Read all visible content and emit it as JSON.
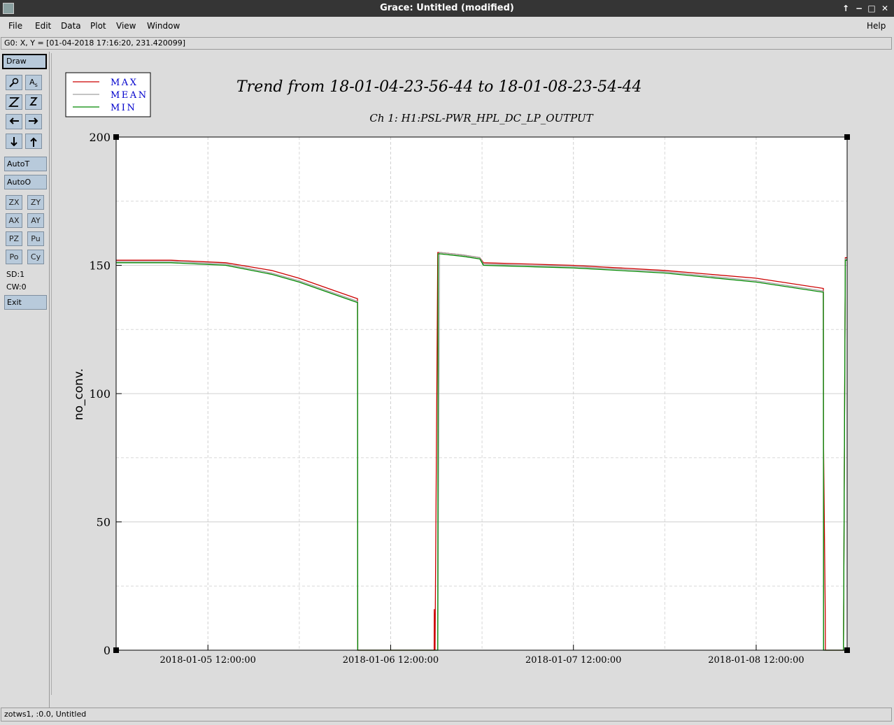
{
  "window": {
    "title": "Grace: Untitled (modified)"
  },
  "menu": {
    "file": "File",
    "edit": "Edit",
    "data": "Data",
    "plot": "Plot",
    "view": "View",
    "window": "Window",
    "help": "Help"
  },
  "locator": "G0: X, Y = [01-04-2018 17:16:20, 231.420099]",
  "toolbar": {
    "draw": "Draw",
    "autoT": "AutoT",
    "autoO": "AutoO",
    "small": [
      "ZX",
      "ZY",
      "AX",
      "AY",
      "PZ",
      "Pu",
      "Po",
      "Cy"
    ],
    "sd": "SD:1",
    "cw": "CW:0",
    "exit": "Exit"
  },
  "status": "zotws1, :0.0, Untitled",
  "colors": {
    "max": "#cc0000",
    "mean": "#a0a0a0",
    "min": "#008800",
    "legendText": "#0000cc"
  },
  "chart_data": {
    "type": "line",
    "title": "Trend from 18-01-04-23-56-44 to 18-01-08-23-54-44",
    "subtitle": "Ch 1: H1:PSL-PWR_HPL_DC_LP_OUTPUT",
    "ylabel": "no_conv.",
    "xlabel": "",
    "x_unit": "days since 2018-01-04 23:56:44",
    "xlim": [
      0,
      4.0
    ],
    "ylim": [
      0,
      200
    ],
    "yticks": [
      0,
      50,
      100,
      150,
      200
    ],
    "xticks": [
      {
        "x": 0.5023,
        "label": "2018-01-05 12:00:00"
      },
      {
        "x": 1.5023,
        "label": "2018-01-06 12:00:00"
      },
      {
        "x": 2.5023,
        "label": "2018-01-07 12:00:00"
      },
      {
        "x": 3.5023,
        "label": "2018-01-08 12:00:00"
      }
    ],
    "grid": true,
    "legend_position": "top-left",
    "series": [
      {
        "name": "MAX",
        "x": [
          0,
          0.3,
          0.6,
          0.85,
          1.0,
          1.2,
          1.3,
          1.321,
          1.322,
          1.74,
          1.741,
          1.745,
          1.76,
          1.77,
          1.9,
          1.99,
          2.01,
          2.5,
          3.0,
          3.5,
          3.87,
          3.871,
          3.88,
          3.881,
          3.98,
          3.99,
          4.0
        ],
        "y": [
          152,
          152,
          151,
          148,
          145,
          140,
          137.5,
          137,
          0,
          0,
          16,
          0,
          155,
          155,
          154,
          153,
          151,
          150,
          148,
          145,
          141,
          80,
          15,
          0,
          0,
          153,
          153
        ]
      },
      {
        "name": "MEAN",
        "x": [
          0,
          0.3,
          0.6,
          0.85,
          1.0,
          1.2,
          1.3,
          1.321,
          1.322,
          1.76,
          1.77,
          1.9,
          1.99,
          2.01,
          2.5,
          3.0,
          3.5,
          3.87,
          3.871,
          3.98,
          3.99,
          4.0
        ],
        "y": [
          151.5,
          151.5,
          150.5,
          147,
          144,
          139,
          136.5,
          136,
          0,
          0,
          155,
          154,
          153,
          150.5,
          149.5,
          147.5,
          144,
          140,
          0,
          0,
          152.5,
          152.5
        ]
      },
      {
        "name": "MIN",
        "x": [
          0,
          0.3,
          0.6,
          0.85,
          1.0,
          1.2,
          1.3,
          1.321,
          1.322,
          1.76,
          1.762,
          1.77,
          1.9,
          1.99,
          2.01,
          2.5,
          3.0,
          3.5,
          3.87,
          3.871,
          3.98,
          3.99,
          4.0
        ],
        "y": [
          151,
          151,
          150,
          146.5,
          143.5,
          138.5,
          136,
          135.5,
          0,
          0,
          154.5,
          154.5,
          153.5,
          152.5,
          150,
          149,
          147,
          143.5,
          139.5,
          0,
          0,
          152,
          152
        ]
      }
    ]
  }
}
